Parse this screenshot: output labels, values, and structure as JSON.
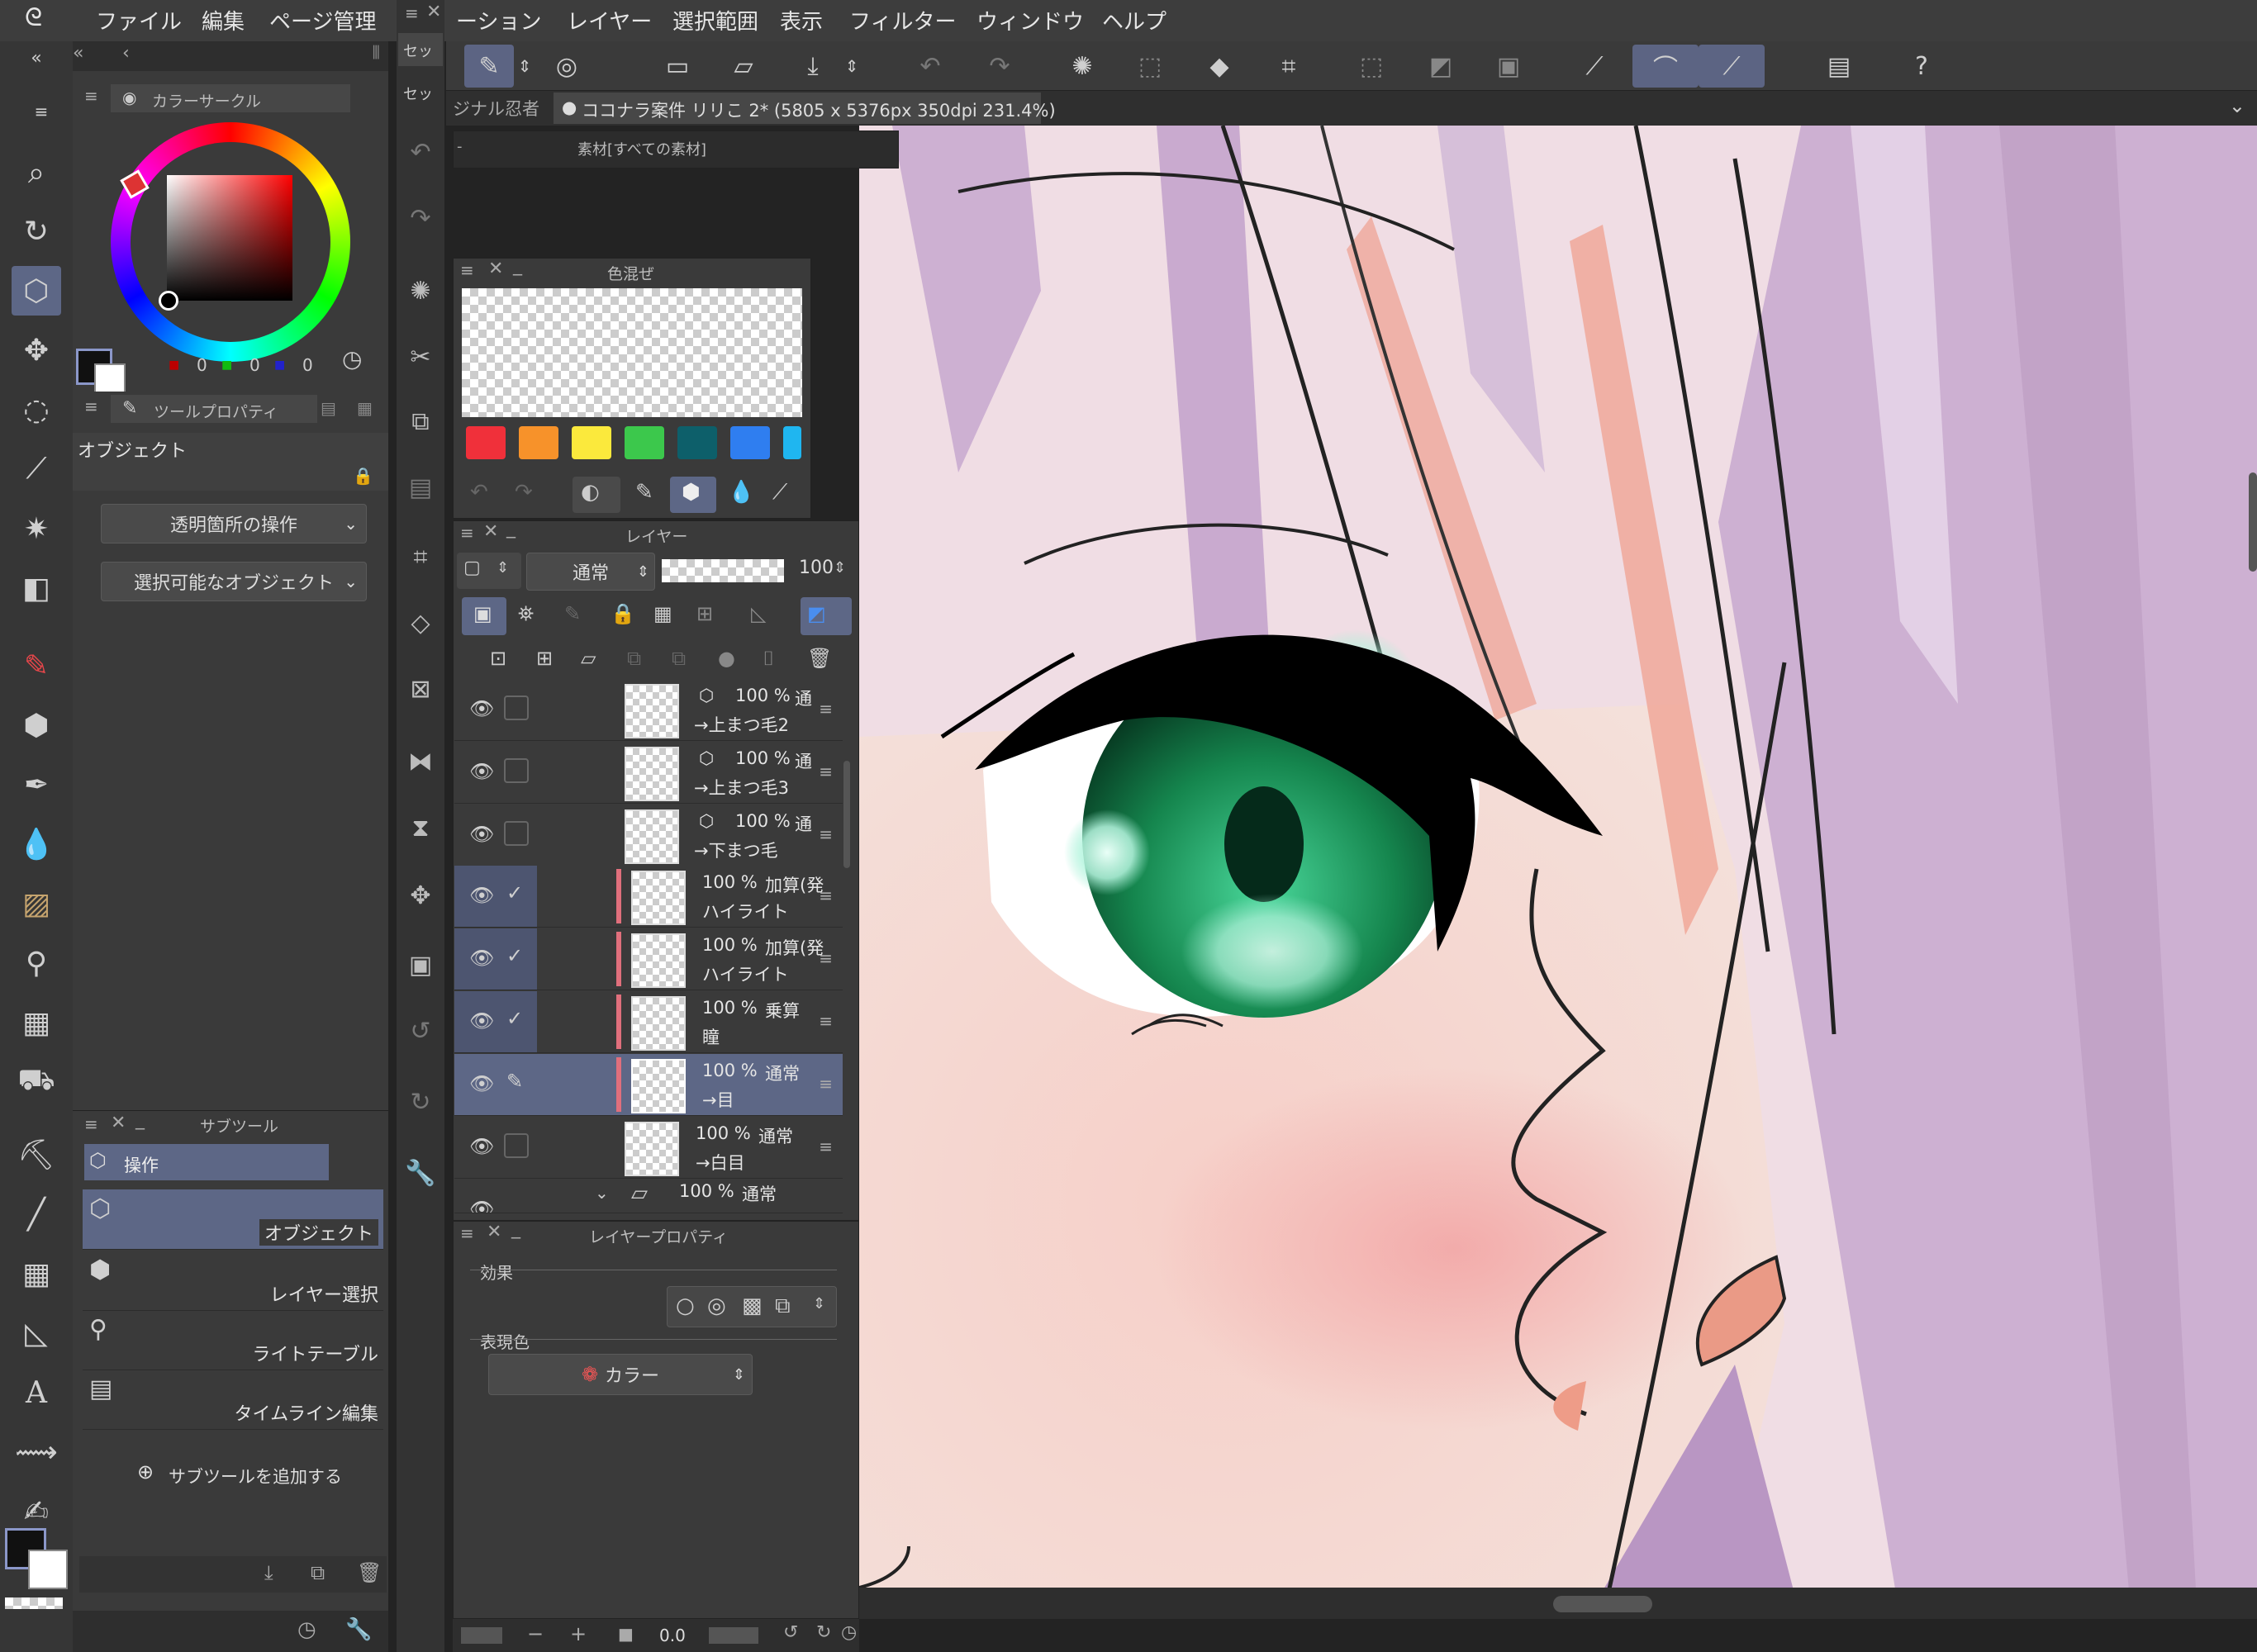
{
  "menu": {
    "items": [
      "ファイル",
      "編集",
      "ページ管理",
      "ーション",
      "レイヤー",
      "選択範囲",
      "表示",
      "フィルター",
      "ウィンドウ",
      "ヘルプ"
    ]
  },
  "document_tabs": {
    "left_tab": "ジナル忍者",
    "active_tab": "ココナラ案件 リリこ 2* (5805 x 5376px 350dpi 231.4%)"
  },
  "material_panel": {
    "title": "素材[すべての素材]"
  },
  "color_circle": {
    "title": "カラーサークル",
    "rgb": [
      "0",
      "0",
      "0"
    ]
  },
  "tool_property": {
    "title": "ツールプロパティ",
    "tool_name": "オブジェクト",
    "transparent_op": "透明箇所の操作",
    "selectable_obj": "選択可能なオブジェクト"
  },
  "color_mix": {
    "title": "色混ぜ",
    "swatches": [
      "#f0303a",
      "#f7922a",
      "#fbe93c",
      "#3cc84c",
      "#0d5f6a",
      "#2f7ef0",
      "#1fb6f0"
    ]
  },
  "layer_panel": {
    "title": "レイヤー",
    "blend_mode": "通常",
    "opacity": "100",
    "layers": [
      {
        "pct": "100 %",
        "mode": "通",
        "name": "→上まつ毛2"
      },
      {
        "pct": "100 %",
        "mode": "通",
        "name": "→上まつ毛3"
      },
      {
        "pct": "100 %",
        "mode": "通",
        "name": "→下まつ毛"
      },
      {
        "pct": "100 %",
        "mode": "加算(発",
        "name": "ハイライト"
      },
      {
        "pct": "100 %",
        "mode": "加算(発",
        "name": "ハイライト"
      },
      {
        "pct": "100 %",
        "mode": "乗算",
        "name": "瞳"
      },
      {
        "pct": "100 %",
        "mode": "通常",
        "name": "→目"
      },
      {
        "pct": "100 %",
        "mode": "通常",
        "name": "→白目"
      },
      {
        "pct": "100 %",
        "mode": "通常",
        "name": ""
      }
    ]
  },
  "layer_property": {
    "title": "レイヤープロパティ",
    "effect_label": "効果",
    "expression_label": "表現色",
    "expression_value": "カラー"
  },
  "subtool": {
    "title": "サブツール",
    "group": "操作",
    "items": [
      "オブジェクト",
      "レイヤー選択",
      "ライトテーブル",
      "タイムライン編集"
    ],
    "add_label": "サブツールを追加する"
  },
  "mid_strip": {
    "tab1": "セッ",
    "tab2": "セッ"
  },
  "status": {
    "angle": "0.0"
  },
  "colors": {
    "accent": "#5d6786",
    "layer_mark": "#e06f7c",
    "panel": "#3a3a3a",
    "canvas_bg": "#f0d6de"
  }
}
